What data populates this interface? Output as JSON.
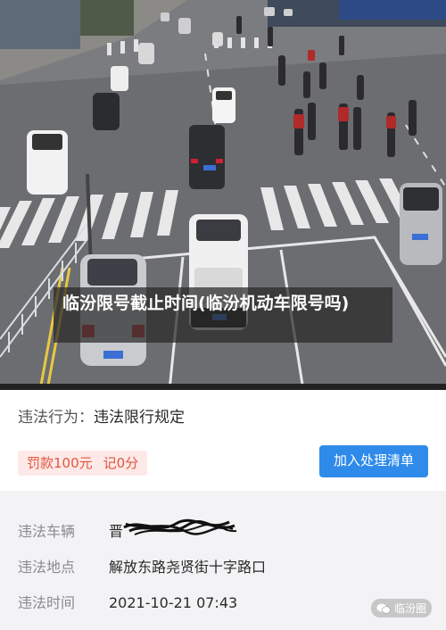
{
  "overlay": {
    "title": "临汾限号截止时间(临汾机动车限号吗)"
  },
  "violation": {
    "behavior_label": "违法行为：",
    "behavior_value": "违法限行规定",
    "fine": "罚款100元",
    "points": "记0分",
    "add_button": "加入处理清单"
  },
  "details": [
    {
      "key": "违法车辆",
      "value": "晋"
    },
    {
      "key": "违法地点",
      "value": "解放东路尧贤街十字路口"
    },
    {
      "key": "违法时间",
      "value": "2021-10-21 07:43"
    }
  ],
  "watermark": {
    "text": "临汾圈",
    "icon": "wechat-icon"
  },
  "colors": {
    "accent": "#2f8bea",
    "fine_text": "#e0553f",
    "fine_bg": "#fde9e7"
  }
}
